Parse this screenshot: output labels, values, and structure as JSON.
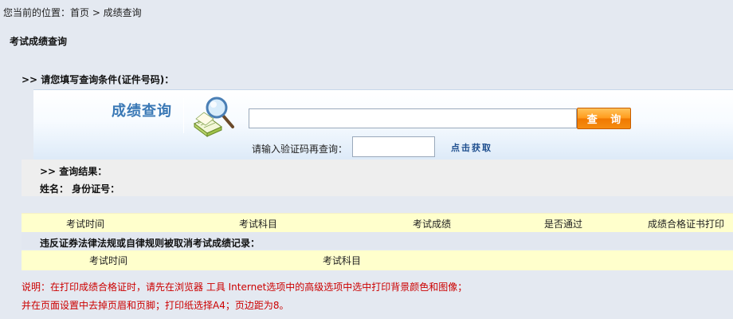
{
  "breadcrumb": "您当前的位置：首页 > 成绩查询",
  "page_title": "考试成绩查询",
  "condition_label": ">> 请您填写查询条件(证件号码)：",
  "query_panel": {
    "heading": "成绩查询",
    "search_value": "",
    "search_placeholder": "",
    "query_button": "查 询",
    "captcha_label": "请输入验证码再查询：",
    "captcha_value": "",
    "get_captcha": "点击获取",
    "icon": "book-magnifier-icon"
  },
  "result": {
    "heading": ">> 查询结果：",
    "name_line": "姓名：  身份证号："
  },
  "score_table": {
    "columns": [
      "考试时间",
      "考试科目",
      "考试成绩",
      "是否通过",
      "成绩合格证书打印"
    ]
  },
  "violation": {
    "label": "违反证券法律法规或自律规则被取消考试成绩记录：",
    "columns": [
      "考试时间",
      "考试科目"
    ]
  },
  "notes": [
    "说明：在打印成绩合格证时，请先在浏览器 工具 Internet选项中的高级选项中选中打印背景颜色和图像；",
    "并在页面设置中去掉页眉和页脚；打印纸选择A4；页边距为8。"
  ],
  "colors": {
    "background": "#e4e9f1",
    "heading_blue": "#3a78b5",
    "button_orange": "#f58c10",
    "table_header": "#ffffcc",
    "note_red": "#cc0000"
  }
}
